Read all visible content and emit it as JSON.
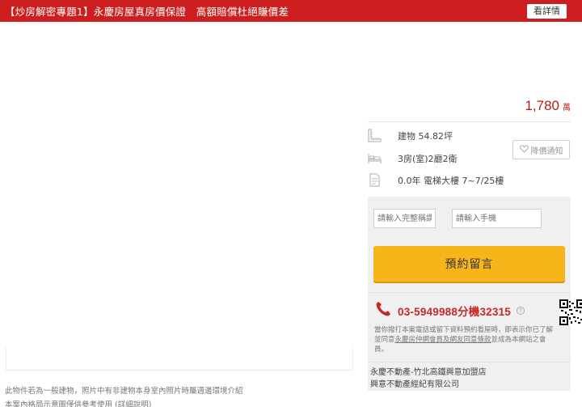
{
  "banner": {
    "text": "【炒房解密專題1】永慶房屋真房價保證　高額賠償杜絕賺價差",
    "button_label": "看詳情",
    "color": "#cc1e1e"
  },
  "footnotes": {
    "line1": "此物件若為一般建物，照片中有非建物本身室內照片時屬週邊環境介紹",
    "line2_prefix": "本案內格局示意圖僅供參考使用",
    "line2_link": "(詳細說明)"
  },
  "price": {
    "value": "1,780",
    "unit": "萬",
    "color": "#b71c1c"
  },
  "details": {
    "area": "建物 54.82坪",
    "layout": "3房(室)2廳2衛",
    "building": "0.0年  電梯大樓 7~7/25樓",
    "icons": [
      "ruler-icon",
      "bed-icon",
      "document-icon"
    ]
  },
  "notify": {
    "label": "降價通知",
    "icon": "heart-icon"
  },
  "form": {
    "name_placeholder": "請輸入完整稱謂",
    "phone_placeholder": "請輸入手機",
    "submit_label": "預約留言",
    "button_color": "#f7b51a"
  },
  "contact": {
    "phone": "03-5949988分機32315",
    "help_icon": "?",
    "note_prefix": "當你撥打本案電話或留下資料預約看屋時，即表示你已了解並同意",
    "note_link1": "永慶房仲網會員及網友同意條款",
    "note_suffix": "並成為本網站之會員。"
  },
  "agent": {
    "store": "永慶不動產-竹北高鐵興意加盟店",
    "company": "興意不動產經紀有限公司"
  }
}
